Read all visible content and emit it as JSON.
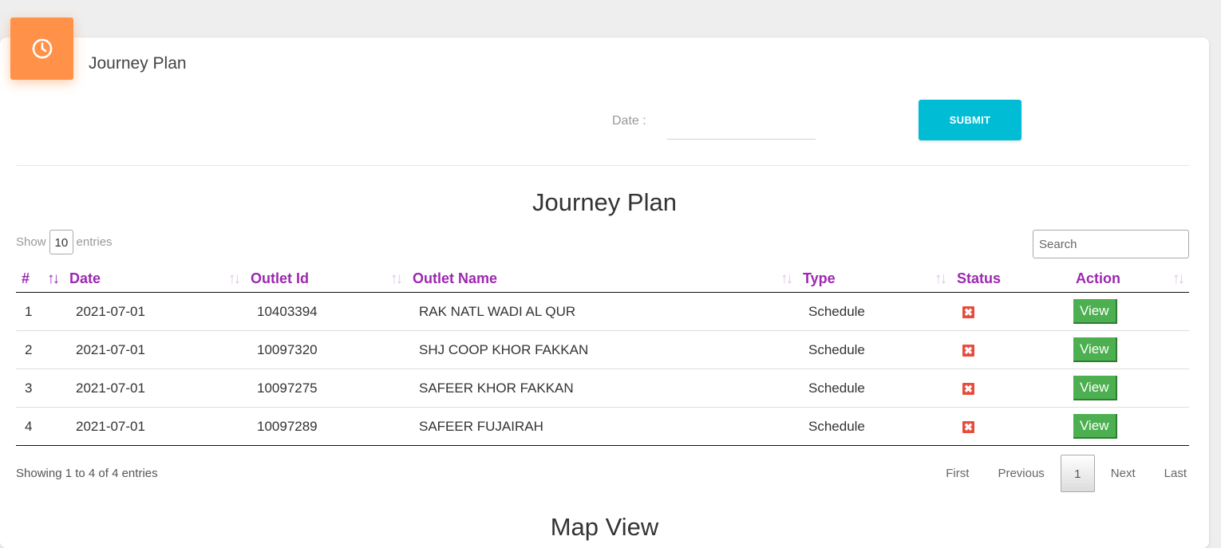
{
  "header": {
    "title": "Journey Plan",
    "icon": "clock-icon",
    "icon_color": "#ff9148"
  },
  "filter": {
    "date_label": "Date :",
    "date_value": "",
    "submit_label": "SUBMIT"
  },
  "table_section": {
    "title": "Journey Plan",
    "length": {
      "show": "Show",
      "value": "10",
      "entries": "entries"
    },
    "search_placeholder": "Search",
    "columns": [
      "#",
      "Date",
      "Outlet Id",
      "Outlet Name",
      "Type",
      "Status",
      "Action"
    ],
    "rows": [
      {
        "num": "1",
        "date": "2021-07-01",
        "outlet_id": "10403394",
        "outlet_name": "RAK NATL WADI AL QUR",
        "type": "Schedule",
        "status": "✖",
        "action": "View"
      },
      {
        "num": "2",
        "date": "2021-07-01",
        "outlet_id": "10097320",
        "outlet_name": "SHJ COOP KHOR FAKKAN",
        "type": "Schedule",
        "status": "✖",
        "action": "View"
      },
      {
        "num": "3",
        "date": "2021-07-01",
        "outlet_id": "10097275",
        "outlet_name": "SAFEER KHOR FAKKAN",
        "type": "Schedule",
        "status": "✖",
        "action": "View"
      },
      {
        "num": "4",
        "date": "2021-07-01",
        "outlet_id": "10097289",
        "outlet_name": "SAFEER FUJAIRAH",
        "type": "Schedule",
        "status": "✖",
        "action": "View"
      }
    ],
    "info": "Showing 1 to 4 of 4 entries",
    "pagination": {
      "first": "First",
      "previous": "Previous",
      "current": "1",
      "next": "Next",
      "last": "Last"
    }
  },
  "map_section": {
    "title": "Map View"
  },
  "colors": {
    "accent": "#9c27b0",
    "submit": "#00bcd4",
    "view_button": "#4caf50",
    "status_x": "#e74c3c"
  }
}
